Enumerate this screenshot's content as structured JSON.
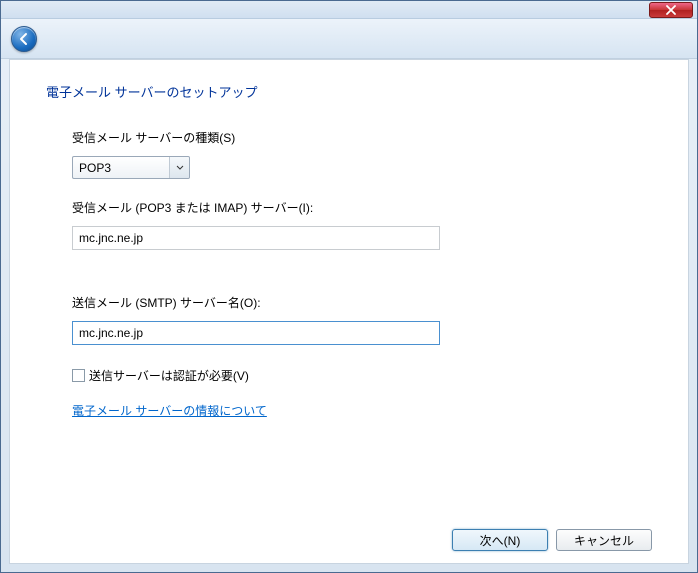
{
  "title": "電子メール サーバーのセットアップ",
  "serverType": {
    "label": "受信メール サーバーの種類(S)",
    "selected": "POP3"
  },
  "incoming": {
    "label": "受信メール (POP3 または IMAP) サーバー(I):",
    "value": "mc.jnc.ne.jp"
  },
  "outgoing": {
    "label": "送信メール (SMTP) サーバー名(O):",
    "value": "mc.jnc.ne.jp"
  },
  "authCheckbox": {
    "label": "送信サーバーは認証が必要(V)",
    "checked": false
  },
  "infoLink": "電子メール サーバーの情報について",
  "buttons": {
    "next": "次へ(N)",
    "cancel": "キャンセル"
  }
}
